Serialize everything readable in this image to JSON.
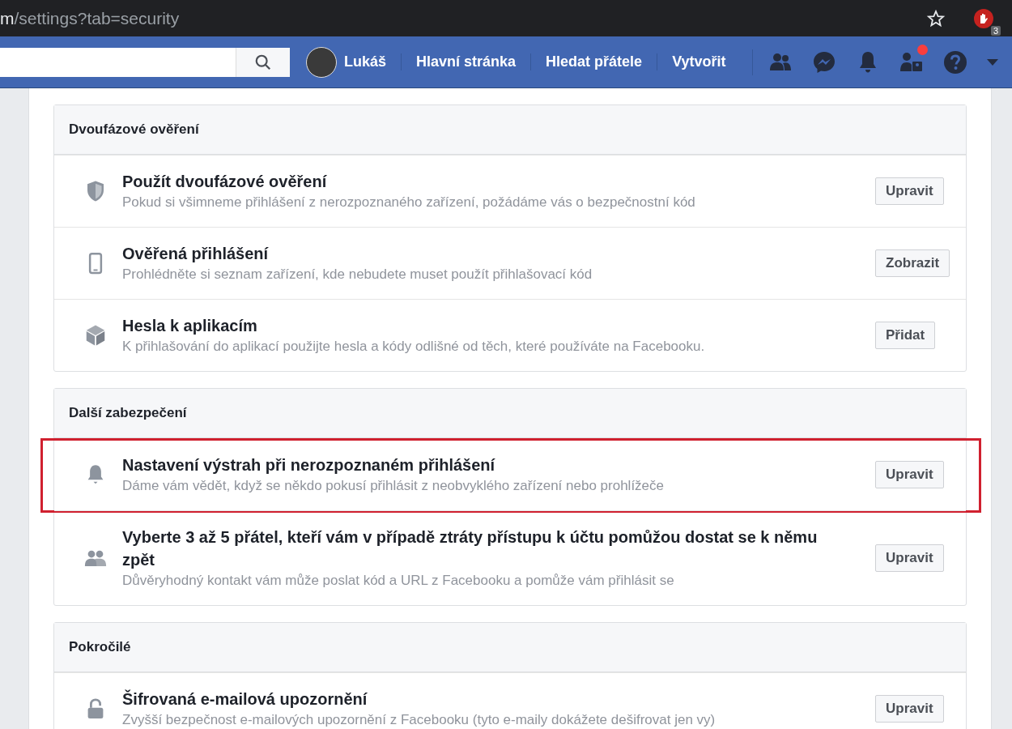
{
  "browser": {
    "url_host_tail": "m",
    "url_path": "/settings?tab=security",
    "extension_badge": "3"
  },
  "navbar": {
    "user": "Lukáš",
    "links": [
      "Hlavní stránka",
      "Hledat přátele",
      "Vytvořit"
    ],
    "friend_requests_dot": true
  },
  "sections": [
    {
      "title": "Dvoufázové ověření",
      "items": [
        {
          "kind": "shield",
          "title": "Použít dvoufázové ověření",
          "description": "Pokud si všimneme přihlášení z nerozpoznaného zařízení, požádáme vás o bezpečnostní kód",
          "button": "Upravit",
          "highlighted": false
        },
        {
          "kind": "phone",
          "title": "Ověřená přihlášení",
          "description": "Prohlédněte si seznam zařízení, kde nebudete muset použít přihlašovací kód",
          "button": "Zobrazit",
          "highlighted": false
        },
        {
          "kind": "cube",
          "title": "Hesla k aplikacím",
          "description": "K přihlašování do aplikací použijte hesla a kódy odlišné od těch, které používáte na Facebooku.",
          "button": "Přidat",
          "highlighted": false
        }
      ]
    },
    {
      "title": "Další zabezpečení",
      "items": [
        {
          "kind": "bell",
          "title": "Nastavení výstrah při nerozpoznaném přihlášení",
          "description": "Dáme vám vědět, když se někdo pokusí přihlásit z neobvyklého zařízení nebo prohlížeče",
          "button": "Upravit",
          "highlighted": true
        },
        {
          "kind": "people",
          "title": "Vyberte 3 až 5 přátel, kteří vám v případě ztráty přístupu k účtu pomůžou dostat se k němu zpět",
          "description": "Důvěryhodný kontakt vám může poslat kód a URL z Facebooku a pomůže vám přihlásit se",
          "button": "Upravit",
          "highlighted": false
        }
      ]
    },
    {
      "title": "Pokročilé",
      "items": [
        {
          "kind": "lock",
          "title": "Šifrovaná e-mailová upozornění",
          "description": "Zvyšší bezpečnost e-mailových upozornění z Facebooku (tyto e-maily dokážete dešifrovat jen vy)",
          "button": "Upravit",
          "highlighted": false
        }
      ]
    }
  ]
}
